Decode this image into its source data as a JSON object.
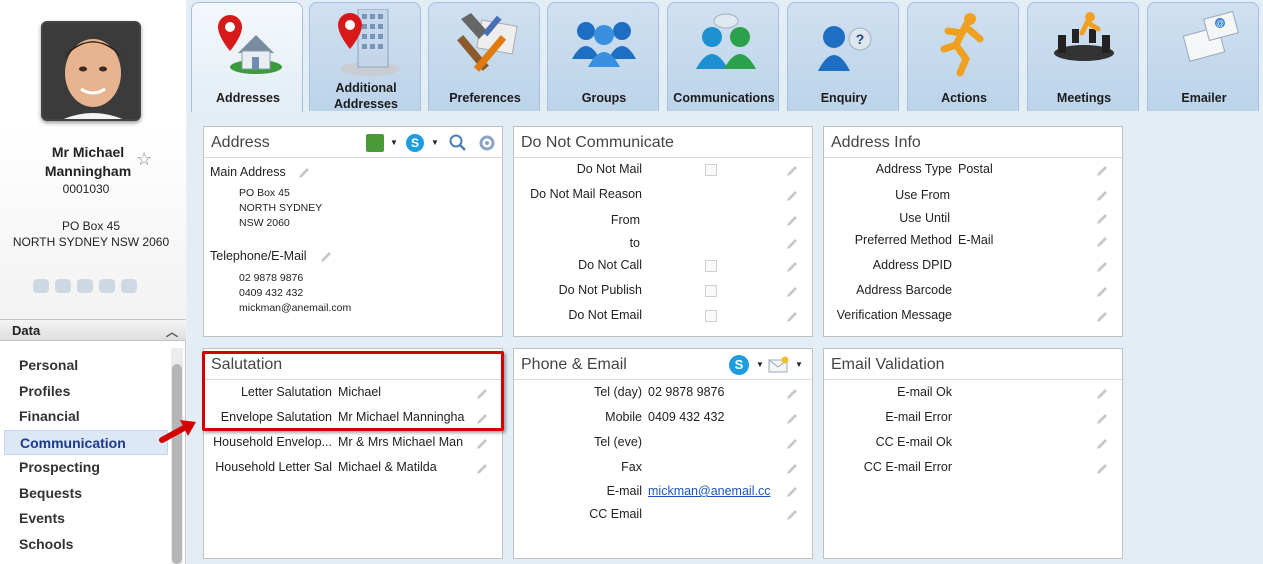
{
  "contact": {
    "name_line1": "Mr Michael",
    "name_line2": "Manningham",
    "id": "0001030",
    "address_line1": "PO Box 45",
    "address_line2": "NORTH SYDNEY NSW 2060"
  },
  "sidebar": {
    "section_title": "Data",
    "items": [
      {
        "label": "Personal",
        "active": false
      },
      {
        "label": "Profiles",
        "active": false
      },
      {
        "label": "Financial",
        "active": false
      },
      {
        "label": "Communication",
        "active": true
      },
      {
        "label": "Prospecting",
        "active": false
      },
      {
        "label": "Bequests",
        "active": false
      },
      {
        "label": "Events",
        "active": false
      },
      {
        "label": "Schools",
        "active": false
      }
    ]
  },
  "tabs": [
    {
      "label": "Addresses",
      "icon": "house-pin-icon",
      "active": true
    },
    {
      "label_line1": "Additional",
      "label_line2": "Addresses",
      "icon": "building-pin-icon"
    },
    {
      "label": "Preferences",
      "icon": "tools-icon"
    },
    {
      "label": "Groups",
      "icon": "group-icon"
    },
    {
      "label": "Communications",
      "icon": "communications-icon"
    },
    {
      "label": "Enquiry",
      "icon": "enquiry-icon"
    },
    {
      "label": "Actions",
      "icon": "running-man-icon"
    },
    {
      "label": "Meetings",
      "icon": "meeting-icon"
    },
    {
      "label": "Emailer",
      "icon": "emailer-icon"
    }
  ],
  "address_panel": {
    "title": "Address",
    "main_label": "Main Address",
    "main_lines": [
      "PO Box 45",
      "NORTH SYDNEY",
      "NSW 2060"
    ],
    "tel_label": "Telephone/E-Mail",
    "tel_lines": [
      "02 9878 9876",
      "0409 432 432",
      "mickman@anemail.com"
    ]
  },
  "dnc_panel": {
    "title": "Do Not Communicate",
    "rows": [
      {
        "label": "Do Not Mail",
        "value": "",
        "checkbox": true
      },
      {
        "label": "Do Not Mail Reason",
        "value": ""
      },
      {
        "label": "From",
        "value": ""
      },
      {
        "label": "to",
        "value": ""
      },
      {
        "label": "Do Not Call",
        "value": "",
        "checkbox": true
      },
      {
        "label": "Do Not Publish",
        "value": "",
        "checkbox": true
      },
      {
        "label": "Do Not Email",
        "value": "",
        "checkbox": true
      }
    ]
  },
  "address_info_panel": {
    "title": "Address Info",
    "rows": [
      {
        "label": "Address Type",
        "value": "Postal"
      },
      {
        "label": "Use From",
        "value": ""
      },
      {
        "label": "Use Until",
        "value": ""
      },
      {
        "label": "Preferred Method",
        "value": "E-Mail"
      },
      {
        "label": "Address DPID",
        "value": ""
      },
      {
        "label": "Address Barcode",
        "value": ""
      },
      {
        "label": "Verification Message",
        "value": ""
      }
    ]
  },
  "salutation_panel": {
    "title": "Salutation",
    "rows": [
      {
        "label": "Letter Salutation",
        "value": "Michael"
      },
      {
        "label": "Envelope Salutation",
        "value": "Mr Michael Manningha"
      },
      {
        "label": "Household Envelop...",
        "value": "Mr & Mrs Michael Man"
      },
      {
        "label": "Household Letter Sal",
        "value": "Michael & Matilda"
      }
    ]
  },
  "phone_panel": {
    "title": "Phone & Email",
    "rows": [
      {
        "label": "Tel (day)",
        "value": "02 9878 9876"
      },
      {
        "label": "Mobile",
        "value": "0409 432 432"
      },
      {
        "label": "Tel (eve)",
        "value": ""
      },
      {
        "label": "Fax",
        "value": ""
      },
      {
        "label": "E-mail",
        "value": "mickman@anemail.cc"
      },
      {
        "label": "CC Email",
        "value": ""
      }
    ]
  },
  "email_validation_panel": {
    "title": "Email Validation",
    "rows": [
      {
        "label": "E-mail Ok",
        "value": ""
      },
      {
        "label": "E-mail Error",
        "value": ""
      },
      {
        "label": "CC E-mail Ok",
        "value": ""
      },
      {
        "label": "CC E-mail Error",
        "value": ""
      }
    ]
  },
  "colors": {
    "highlight": "#d40000",
    "active_nav": "#1a3a8c",
    "link": "#1a56b8"
  }
}
